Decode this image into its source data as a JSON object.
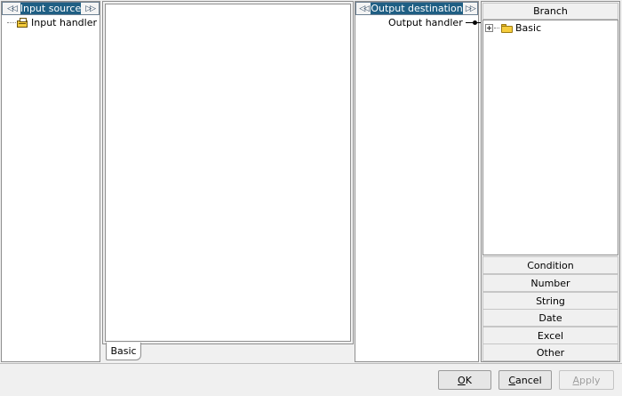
{
  "input_panel": {
    "title": "Input source",
    "prev_glyph": "◁◁",
    "next_glyph": "▷▷",
    "tree": [
      {
        "label": "Input handler",
        "icon": "input-handler-icon"
      }
    ]
  },
  "canvas": {
    "tabs": [
      {
        "label": "Basic",
        "active": true
      }
    ]
  },
  "output_panel": {
    "title": "Output destination",
    "prev_glyph": "◁◁",
    "next_glyph": "▷▷",
    "tree": [
      {
        "label": "Output handler",
        "icon": "connector-icon"
      }
    ]
  },
  "branch_panel": {
    "header": "Branch",
    "tree": [
      {
        "label": "Basic",
        "icon": "folder-icon",
        "expandable": true
      }
    ],
    "categories": [
      "Condition",
      "Number",
      "String",
      "Date",
      "Excel",
      "Other"
    ]
  },
  "footer": {
    "ok": {
      "accel": "O",
      "rest": "K"
    },
    "cancel": {
      "accel": "C",
      "rest": "ancel"
    },
    "apply": {
      "accel": "A",
      "rest": "pply",
      "enabled": false
    }
  },
  "colors": {
    "header_bg": "#1f5f84",
    "header_text": "#ffffff"
  }
}
